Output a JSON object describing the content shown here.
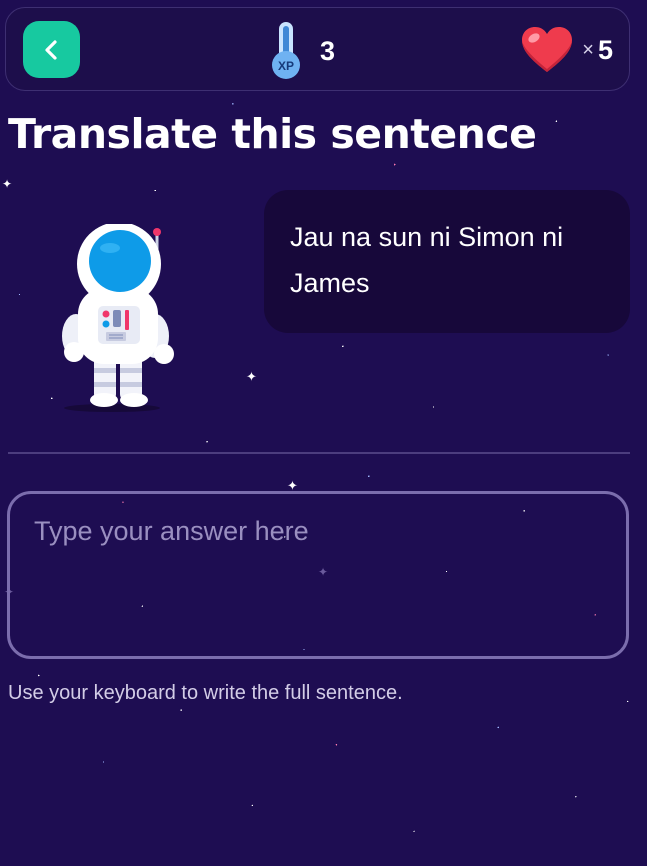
{
  "colors": {
    "background": "#1e0d52",
    "back_button": "#17c9a0",
    "speech_bubble": "#17083a",
    "heart": "#ef3b4d",
    "input_border": "#7b6dad"
  },
  "header": {
    "back_icon": "chevron-left-icon",
    "xp_icon": "xp-thermometer-icon",
    "xp_icon_label": "XP",
    "xp_count": "3",
    "lives_icon": "heart-icon",
    "lives_multiplier": "×",
    "lives_count": "5"
  },
  "main": {
    "title": "Translate this sentence",
    "avatar_icon": "astronaut-icon",
    "sentence": "Jau na sun ni Simon ni James",
    "answer": {
      "value": "",
      "placeholder": "Type your answer here"
    },
    "helper_text": "Use your keyboard to write the full sentence."
  }
}
